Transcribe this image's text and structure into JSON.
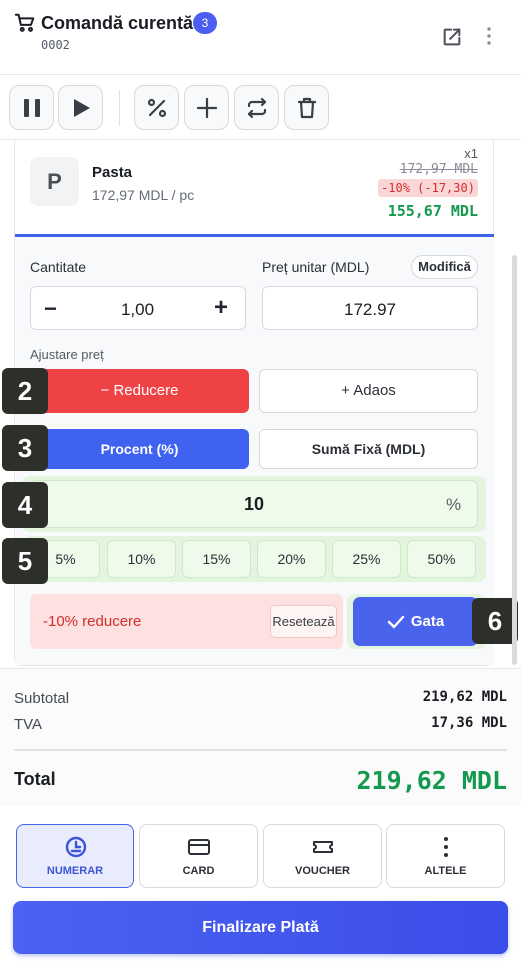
{
  "header": {
    "title": "Comandă curentă",
    "badge": "3",
    "order_no": "0002"
  },
  "product": {
    "initial": "P",
    "name": "Pasta",
    "unit_price": "172,97 MDL / pc",
    "qty": "x1",
    "old_price": "172,97 MDL",
    "discount_badge": "-10% (-17,30)",
    "new_price": "155,67 MDL"
  },
  "editor": {
    "qty_label": "Cantitate",
    "unit_label": "Preț unitar (MDL)",
    "modify": "Modifică",
    "qty_minus": "−",
    "qty_value": "1,00",
    "qty_plus": "+",
    "unit_value": "172.97",
    "adjust_label": "Ajustare preț",
    "reduce": "− Reducere",
    "markup": "+ Adaos",
    "percent": "Procent (%)",
    "fixed": "Sumă Fixă (MDL)",
    "value": "10",
    "value_unit": "%",
    "chips": [
      "5%",
      "10%",
      "15%",
      "20%",
      "25%",
      "50%"
    ],
    "summary": "-10% reducere",
    "reset": "Resetează",
    "done": "Gata"
  },
  "markers": [
    "2",
    "3",
    "4",
    "5",
    "6"
  ],
  "totals": {
    "subtotal_label": "Subtotal",
    "subtotal": "219,62 MDL",
    "vat_label": "TVA",
    "vat": "17,36 MDL",
    "total_label": "Total",
    "total": "219,62 MDL"
  },
  "payment": {
    "methods": [
      "NUMERAR",
      "CARD",
      "VOUCHER",
      "ALTELE"
    ],
    "finalize": "Finalizare Plată"
  },
  "colors": {
    "accent": "#4a63ec",
    "danger": "#ee4245",
    "success": "#15994f"
  }
}
